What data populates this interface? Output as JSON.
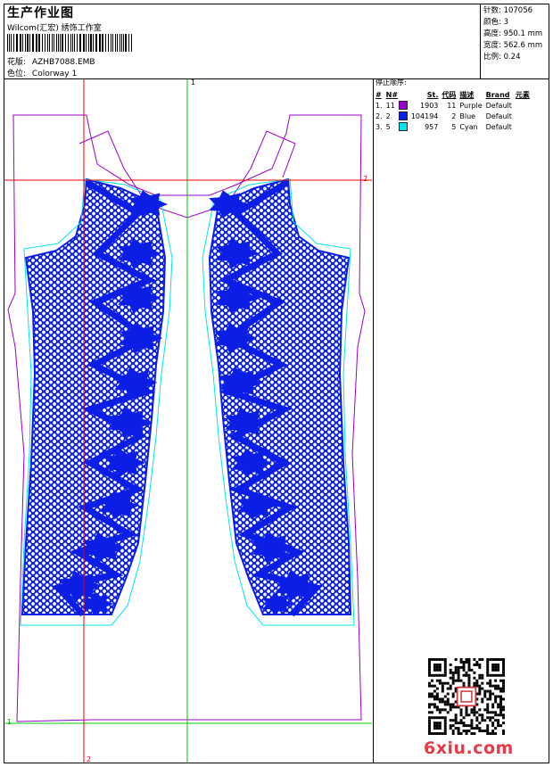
{
  "header": {
    "title": "生产作业图",
    "company": "Wilcom(汇宏) 绣饰工作室",
    "design_file_label": "花版:",
    "design_file": "AZHB7088.EMB",
    "colorway_label": "色位:",
    "colorway": "Colorway 1"
  },
  "stats": {
    "stitches_label": "针数:",
    "stitches": "107056",
    "colors_label": "颜色:",
    "colors": "3",
    "height_label": "高度:",
    "height": "950.1 mm",
    "width_label": "宽度:",
    "width": "562.6 mm",
    "scale_label": "比例:",
    "scale": "0.24"
  },
  "color_table": {
    "title": "停止顺序:",
    "headers": [
      "#",
      "N#",
      "St.",
      "代码",
      "描述",
      "Brand",
      "元素"
    ],
    "rows": [
      {
        "index": "1.",
        "needle": "11",
        "color": "#9900cc",
        "stitches": "1903",
        "code": "11",
        "description": "Purple",
        "brand": "Default"
      },
      {
        "index": "2.",
        "needle": "2",
        "color": "#0a1ee6",
        "stitches": "104194",
        "code": "2",
        "description": "Blue",
        "brand": "Default"
      },
      {
        "index": "3.",
        "needle": "5",
        "color": "#00e5ee",
        "stitches": "957",
        "code": "5",
        "description": "Cyan",
        "brand": "Default"
      }
    ]
  },
  "axis_labels": {
    "top": "1",
    "right": "2",
    "bottom": "2",
    "left": "1"
  },
  "logo": {
    "text": "6xiu.com"
  },
  "colors": {
    "purple": "#9900cc",
    "blue": "#0a1ee6",
    "cyan": "#00e5ee",
    "red": "#ee0000",
    "green": "#00cc00"
  }
}
